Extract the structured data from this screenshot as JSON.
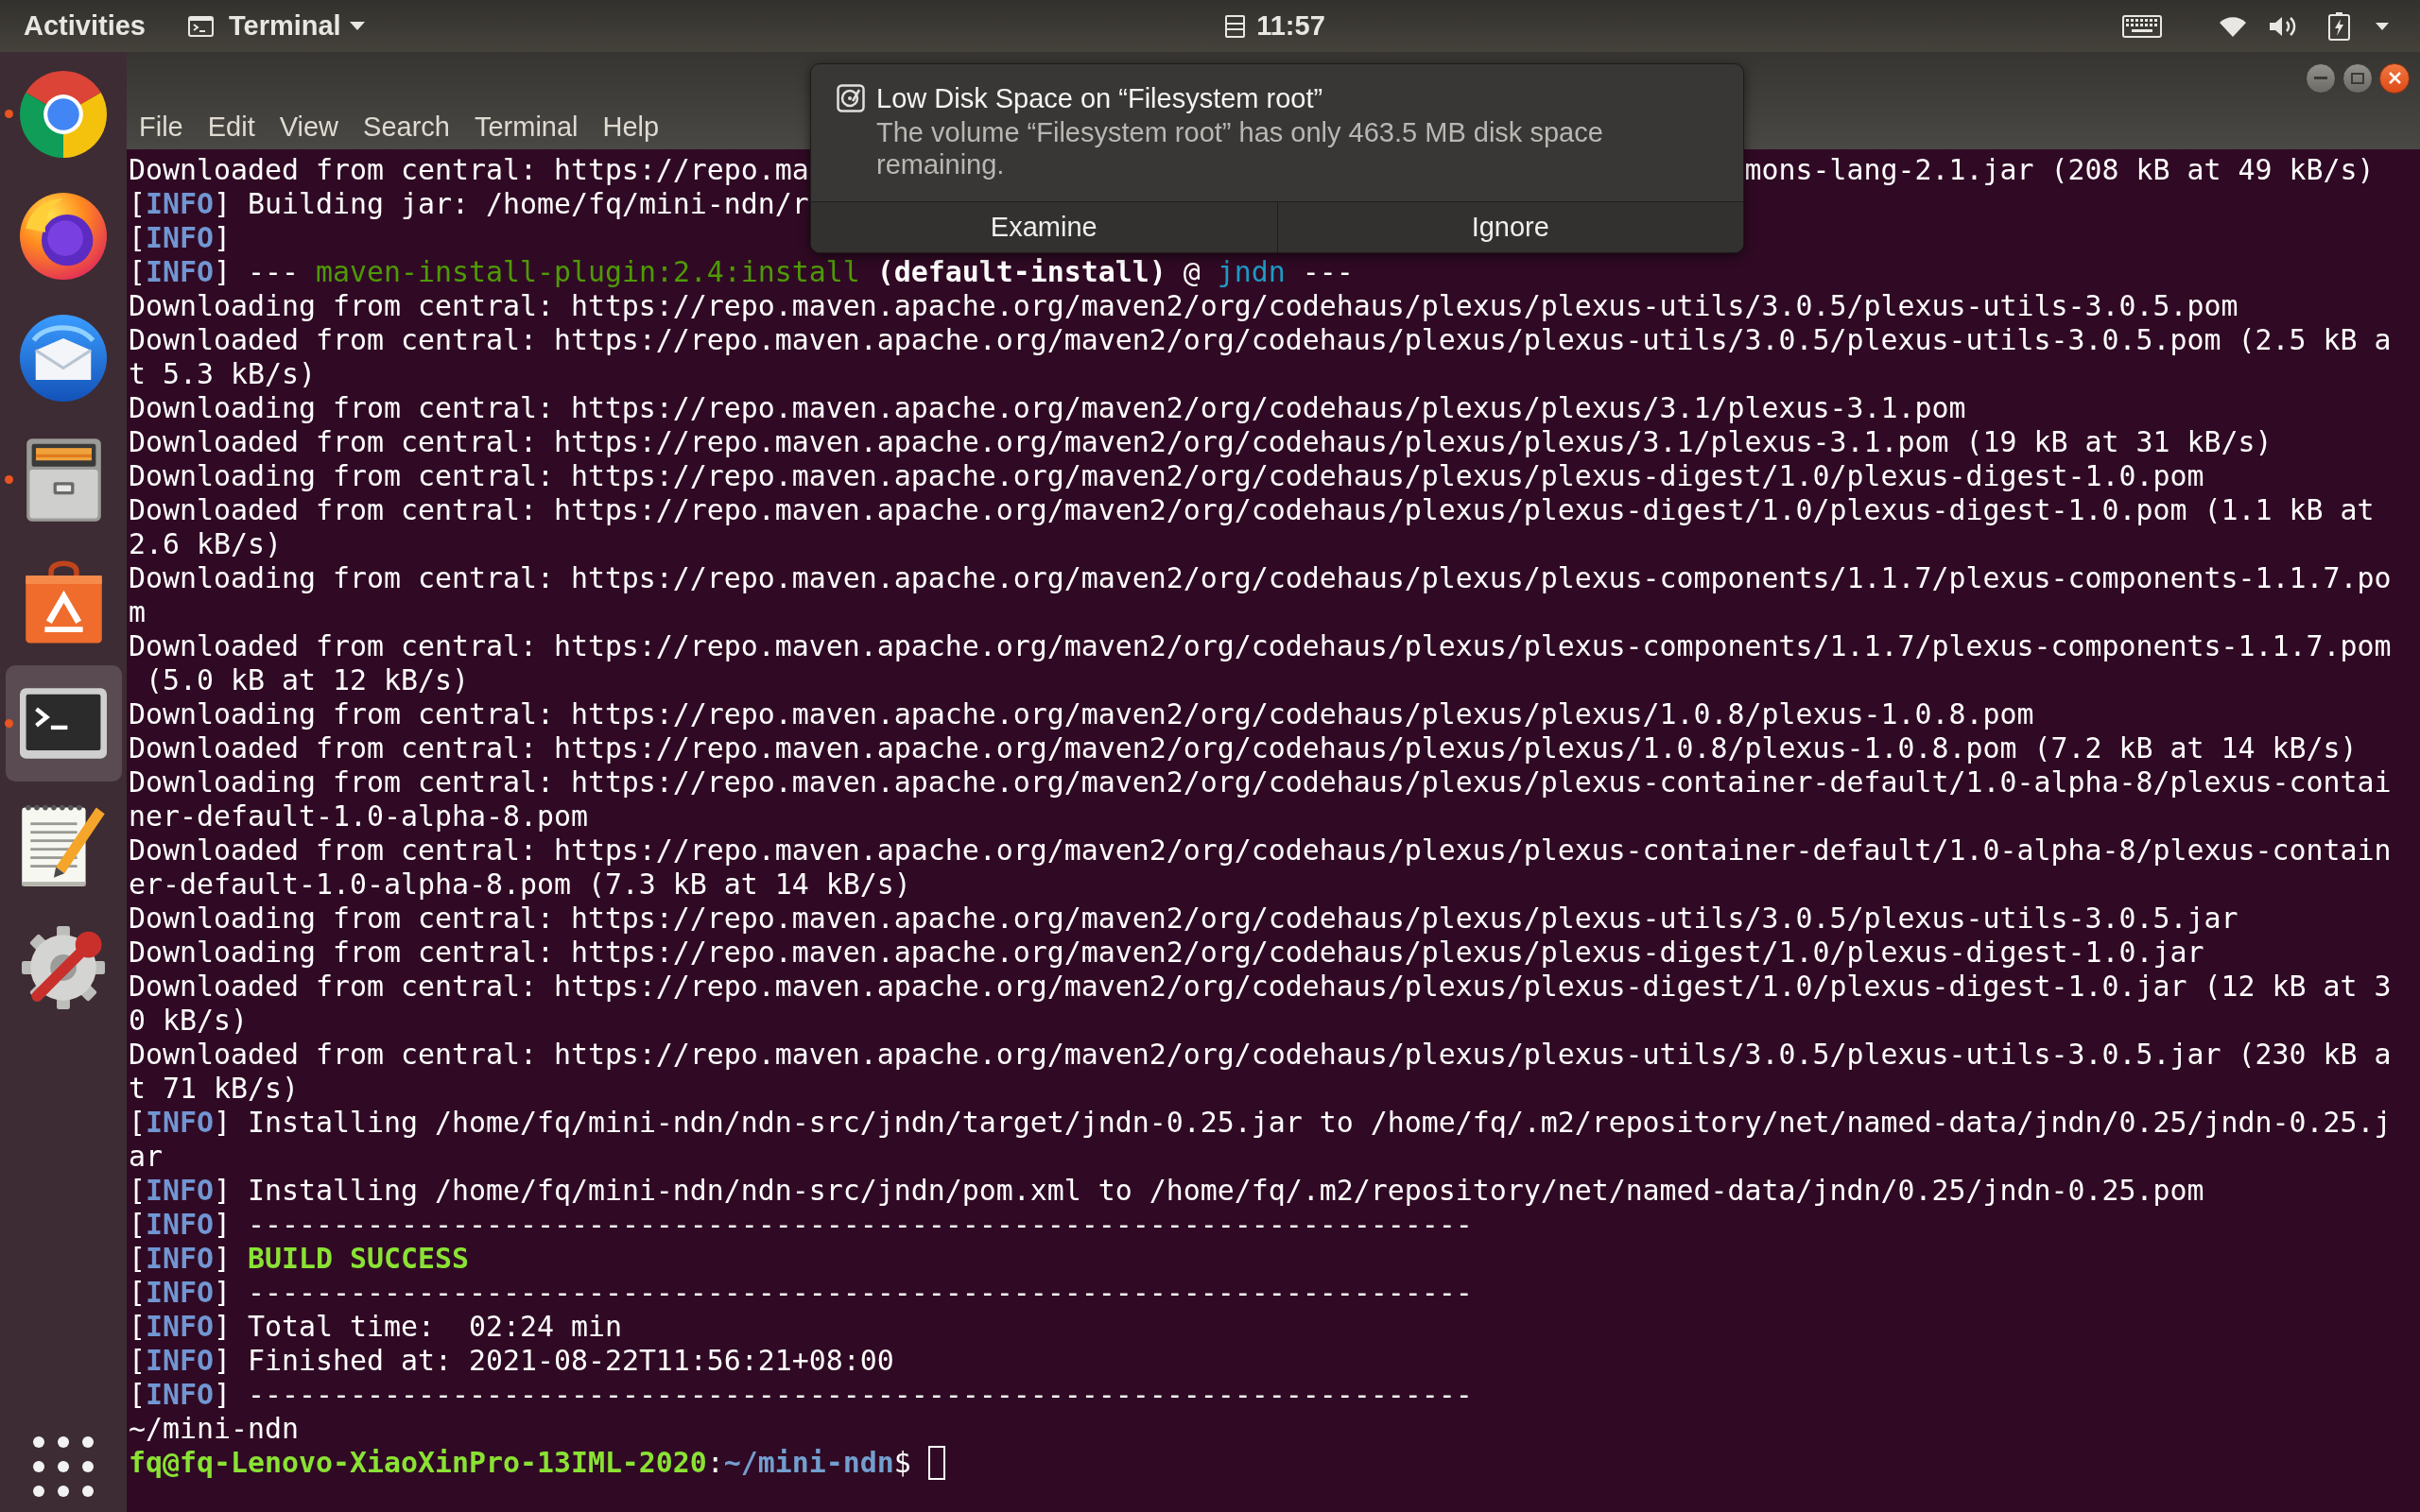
{
  "top_bar": {
    "activities": "Activities",
    "app_menu": "Terminal",
    "clock": "11:57"
  },
  "dock": {
    "items": [
      {
        "kind": "browser",
        "running": true,
        "selected": false
      },
      {
        "kind": "fox",
        "running": false,
        "selected": false
      },
      {
        "kind": "mail",
        "running": false,
        "selected": false
      },
      {
        "kind": "files",
        "running": true,
        "selected": false
      },
      {
        "kind": "store",
        "running": false,
        "selected": false
      },
      {
        "kind": "terminal",
        "running": true,
        "selected": true
      },
      {
        "kind": "notes",
        "running": false,
        "selected": false
      },
      {
        "kind": "settings",
        "running": false,
        "selected": false
      }
    ]
  },
  "window": {
    "menu": [
      "File",
      "Edit",
      "View",
      "Search",
      "Terminal",
      "Help"
    ]
  },
  "terminal": {
    "lines": [
      {
        "text": "Downloaded from central: https://repo.ma",
        "after_notification": "mons-lang-2.1.jar (208 kB at 49 kB/s)"
      },
      {
        "segments": [
          {
            "text": "[",
            "kind": "plain"
          },
          {
            "text": "INFO",
            "kind": "info"
          },
          {
            "text": "] Building jar: /home/fq/mini-ndn/r",
            "kind": "plain"
          }
        ]
      },
      {
        "segments": [
          {
            "text": "[",
            "kind": "plain"
          },
          {
            "text": "INFO",
            "kind": "info"
          },
          {
            "text": "]",
            "kind": "plain"
          }
        ]
      },
      {
        "segments": [
          {
            "text": "[",
            "kind": "plain"
          },
          {
            "text": "INFO",
            "kind": "info"
          },
          {
            "text": "] --- ",
            "kind": "plain"
          },
          {
            "text": "maven-install-plugin:2.4:install",
            "kind": "plugin"
          },
          {
            "text": " (default-install)",
            "kind": "bold"
          },
          {
            "text": " @ ",
            "kind": "plain"
          },
          {
            "text": "jndn",
            "kind": "project"
          },
          {
            "text": " ---",
            "kind": "plain"
          }
        ]
      },
      {
        "text": "Downloading from central: https://repo.maven.apache.org/maven2/org/codehaus/plexus/plexus-utils/3.0.5/plexus-utils-3.0.5.pom"
      },
      {
        "text": "Downloaded from central: https://repo.maven.apache.org/maven2/org/codehaus/plexus/plexus-utils/3.0.5/plexus-utils-3.0.5.pom (2.5 kB a"
      },
      {
        "text": "t 5.3 kB/s)"
      },
      {
        "text": "Downloading from central: https://repo.maven.apache.org/maven2/org/codehaus/plexus/plexus/3.1/plexus-3.1.pom"
      },
      {
        "text": "Downloaded from central: https://repo.maven.apache.org/maven2/org/codehaus/plexus/plexus/3.1/plexus-3.1.pom (19 kB at 31 kB/s)"
      },
      {
        "text": "Downloading from central: https://repo.maven.apache.org/maven2/org/codehaus/plexus/plexus-digest/1.0/plexus-digest-1.0.pom"
      },
      {
        "text": "Downloaded from central: https://repo.maven.apache.org/maven2/org/codehaus/plexus/plexus-digest/1.0/plexus-digest-1.0.pom (1.1 kB at"
      },
      {
        "text": "2.6 kB/s)"
      },
      {
        "text": "Downloading from central: https://repo.maven.apache.org/maven2/org/codehaus/plexus/plexus-components/1.1.7/plexus-components-1.1.7.po"
      },
      {
        "text": "m"
      },
      {
        "text": "Downloaded from central: https://repo.maven.apache.org/maven2/org/codehaus/plexus/plexus-components/1.1.7/plexus-components-1.1.7.pom"
      },
      {
        "text": " (5.0 kB at 12 kB/s)"
      },
      {
        "text": "Downloading from central: https://repo.maven.apache.org/maven2/org/codehaus/plexus/plexus/1.0.8/plexus-1.0.8.pom"
      },
      {
        "text": "Downloaded from central: https://repo.maven.apache.org/maven2/org/codehaus/plexus/plexus/1.0.8/plexus-1.0.8.pom (7.2 kB at 14 kB/s)"
      },
      {
        "text": "Downloading from central: https://repo.maven.apache.org/maven2/org/codehaus/plexus/plexus-container-default/1.0-alpha-8/plexus-contai"
      },
      {
        "text": "ner-default-1.0-alpha-8.pom"
      },
      {
        "text": "Downloaded from central: https://repo.maven.apache.org/maven2/org/codehaus/plexus/plexus-container-default/1.0-alpha-8/plexus-contain"
      },
      {
        "text": "er-default-1.0-alpha-8.pom (7.3 kB at 14 kB/s)"
      },
      {
        "text": "Downloading from central: https://repo.maven.apache.org/maven2/org/codehaus/plexus/plexus-utils/3.0.5/plexus-utils-3.0.5.jar"
      },
      {
        "text": "Downloading from central: https://repo.maven.apache.org/maven2/org/codehaus/plexus/plexus-digest/1.0/plexus-digest-1.0.jar"
      },
      {
        "text": "Downloaded from central: https://repo.maven.apache.org/maven2/org/codehaus/plexus/plexus-digest/1.0/plexus-digest-1.0.jar (12 kB at 3"
      },
      {
        "text": "0 kB/s)"
      },
      {
        "text": "Downloaded from central: https://repo.maven.apache.org/maven2/org/codehaus/plexus/plexus-utils/3.0.5/plexus-utils-3.0.5.jar (230 kB a"
      },
      {
        "text": "t 71 kB/s)"
      },
      {
        "segments": [
          {
            "text": "[",
            "kind": "plain"
          },
          {
            "text": "INFO",
            "kind": "info"
          },
          {
            "text": "] Installing /home/fq/mini-ndn/ndn-src/jndn/target/jndn-0.25.jar to /home/fq/.m2/repository/net/named-data/jndn/0.25/jndn-0.25.j",
            "kind": "plain"
          }
        ]
      },
      {
        "text": "ar"
      },
      {
        "segments": [
          {
            "text": "[",
            "kind": "plain"
          },
          {
            "text": "INFO",
            "kind": "info"
          },
          {
            "text": "] Installing /home/fq/mini-ndn/ndn-src/jndn/pom.xml to /home/fq/.m2/repository/net/named-data/jndn/0.25/jndn-0.25.pom",
            "kind": "plain"
          }
        ]
      },
      {
        "segments": [
          {
            "text": "[",
            "kind": "plain"
          },
          {
            "text": "INFO",
            "kind": "info"
          },
          {
            "text": "] ------------------------------------------------------------------------",
            "kind": "plain"
          }
        ]
      },
      {
        "segments": [
          {
            "text": "[",
            "kind": "plain"
          },
          {
            "text": "INFO",
            "kind": "info"
          },
          {
            "text": "] ",
            "kind": "plain"
          },
          {
            "text": "BUILD SUCCESS",
            "kind": "success"
          }
        ]
      },
      {
        "segments": [
          {
            "text": "[",
            "kind": "plain"
          },
          {
            "text": "INFO",
            "kind": "info"
          },
          {
            "text": "] ------------------------------------------------------------------------",
            "kind": "plain"
          }
        ]
      },
      {
        "segments": [
          {
            "text": "[",
            "kind": "plain"
          },
          {
            "text": "INFO",
            "kind": "info"
          },
          {
            "text": "] Total time:  02:24 min",
            "kind": "plain"
          }
        ]
      },
      {
        "segments": [
          {
            "text": "[",
            "kind": "plain"
          },
          {
            "text": "INFO",
            "kind": "info"
          },
          {
            "text": "] Finished at: 2021-08-22T11:56:21+08:00",
            "kind": "plain"
          }
        ]
      },
      {
        "segments": [
          {
            "text": "[",
            "kind": "plain"
          },
          {
            "text": "INFO",
            "kind": "info"
          },
          {
            "text": "] ------------------------------------------------------------------------",
            "kind": "plain"
          }
        ]
      },
      {
        "text": "~/mini-ndn"
      }
    ],
    "prompt": {
      "segments": [
        {
          "text": "fq@fq-Lenovo-XiaoXinPro-13IML-2020",
          "kind": "user"
        },
        {
          "text": ":",
          "kind": "plain"
        },
        {
          "text": "~/mini-ndn",
          "kind": "path"
        },
        {
          "text": "$",
          "kind": "plain"
        }
      ],
      "cursor": true
    }
  },
  "notification": {
    "title": "Low Disk Space on “Filesystem root”",
    "body": "The volume “Filesystem root” has only 463.5 MB disk space remaining.",
    "actions": [
      "Examine",
      "Ignore"
    ]
  }
}
